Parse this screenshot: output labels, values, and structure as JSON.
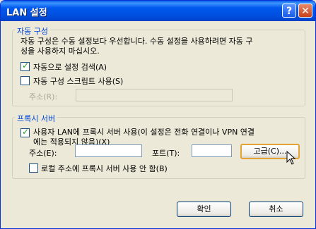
{
  "window": {
    "title": "LAN 설정"
  },
  "titlebar_buttons": {
    "help": "?",
    "close": "✕"
  },
  "auto_config": {
    "legend": "자동 구성",
    "description_line1": "자동 구성은 수동 설정보다 우선합니다. 수동 설정을 사용하려면 자동 구",
    "description_line2": "성을 사용하지 마십시오.",
    "auto_detect": {
      "label": "자동으로 설정 검색(A)",
      "checked": true
    },
    "use_script": {
      "label": "자동 구성 스크립트 사용(S)",
      "checked": false
    },
    "address_label": "주소(R):",
    "address_value": ""
  },
  "proxy": {
    "legend": "프록시 서버",
    "use_proxy": {
      "label_line1": "사용자 LAN에 프록시 서버 사용(이 설정은 전화 연결이나 VPN 연결",
      "label_line2": "에는 적용되지 않음)(X)",
      "checked": true
    },
    "address_label": "주소(E):",
    "address_value": "",
    "port_label": "포트(T):",
    "port_value": "",
    "advanced_button": "고급(C)...",
    "bypass_local": {
      "label": "로컬 주소에 프록시 서버 사용 안 함(B)",
      "checked": false
    }
  },
  "buttons": {
    "ok": "확인",
    "cancel": "취소"
  }
}
